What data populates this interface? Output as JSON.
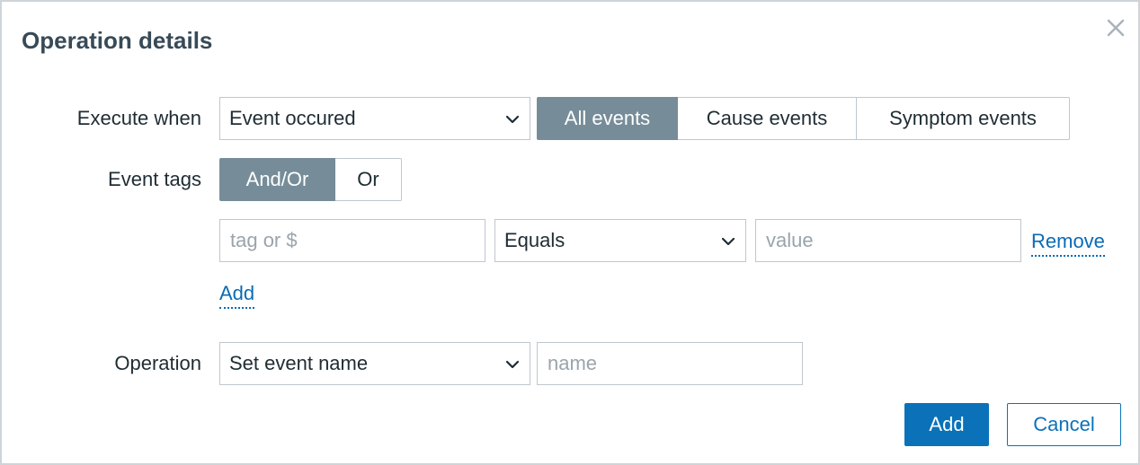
{
  "dialog": {
    "title": "Operation details",
    "close_icon": "close-icon"
  },
  "execute_when": {
    "label": "Execute when",
    "selected": "Event occured",
    "event_filter": [
      "All events",
      "Cause events",
      "Symptom events"
    ],
    "event_filter_active": "All events"
  },
  "event_tags": {
    "label": "Event tags",
    "evaltype": [
      "And/Or",
      "Or"
    ],
    "evaltype_active": "And/Or",
    "rows": [
      {
        "tag_placeholder": "tag or $",
        "tag_value": "",
        "operator": "Equals",
        "value_placeholder": "value",
        "value_value": "",
        "remove_label": "Remove"
      }
    ],
    "add_label": "Add"
  },
  "operation": {
    "label": "Operation",
    "selected": "Set event name",
    "name_placeholder": "name",
    "name_value": ""
  },
  "footer": {
    "add_label": "Add",
    "cancel_label": "Cancel"
  },
  "colors": {
    "accent": "#0b72b9",
    "segment_active": "#768d99",
    "border": "#bfc7ce",
    "title": "#384a57"
  }
}
